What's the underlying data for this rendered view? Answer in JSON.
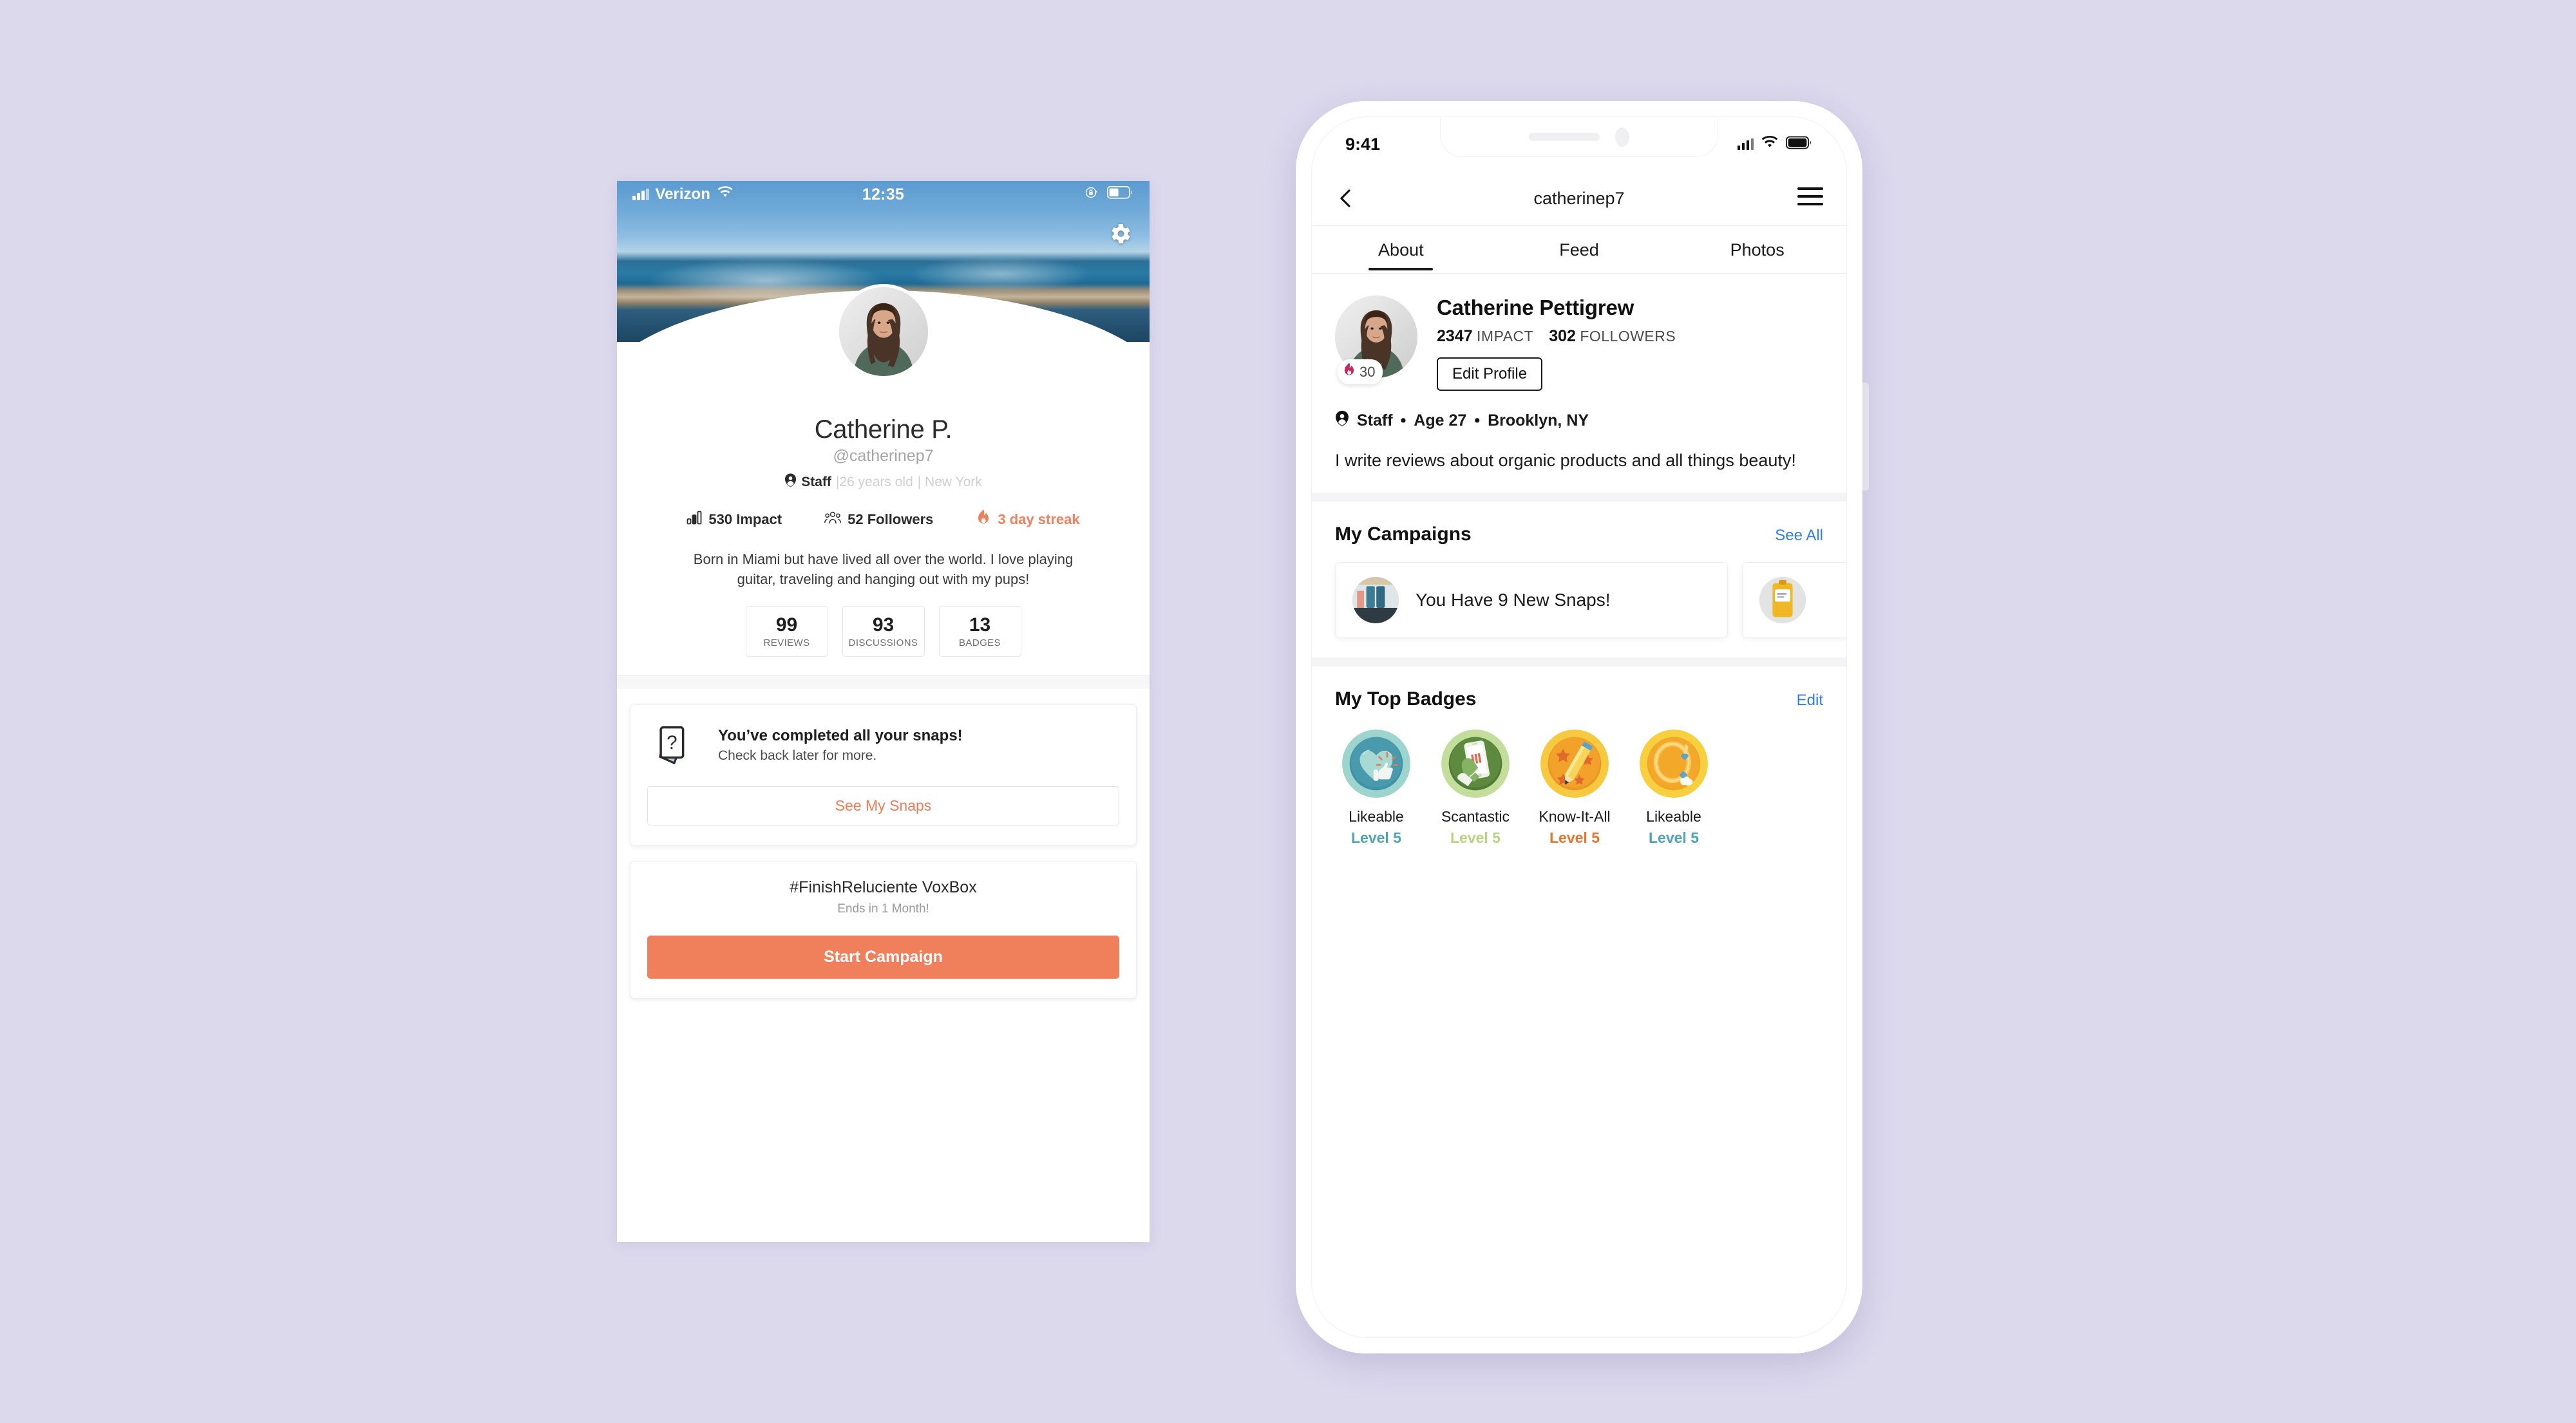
{
  "page": {
    "background_color": "#dcd9ed"
  },
  "left_phone": {
    "status_bar": {
      "carrier": "Verizon",
      "time": "12:35",
      "wifi_icon": "wifi-icon",
      "signal_icon": "signal-bars-icon",
      "orientation_lock_icon": "rotation-lock-icon",
      "battery_icon": "battery-icon"
    },
    "settings_icon": "gear-icon",
    "profile": {
      "avatar": "user-avatar",
      "name": "Catherine P.",
      "handle": "@catherinep7",
      "role_icon": "staff-badge-icon",
      "role": "Staff",
      "age": "|26 years old",
      "location": "| New York"
    },
    "stats": [
      {
        "icon": "impact-bars-icon",
        "label": "530 Impact"
      },
      {
        "icon": "followers-icon",
        "label": "52 Followers"
      },
      {
        "icon": "flame-icon",
        "label": "3 day streak",
        "color": "#f08060"
      }
    ],
    "bio": "Born in Miami but have lived all over the world. I love playing guitar, traveling and hanging out with my pups!",
    "counters": [
      {
        "value": "99",
        "label": "REVIEWS"
      },
      {
        "value": "93",
        "label": "DISCUSSIONS"
      },
      {
        "value": "13",
        "label": "BADGES"
      }
    ],
    "snaps_card": {
      "icon": "question-cards-icon",
      "heading": "You’ve completed all your snaps!",
      "subheading": "Check back later for more.",
      "button": "See My Snaps",
      "button_color": "#ef7b55"
    },
    "campaign_card": {
      "title": "#FinishReluciente VoxBox",
      "subtitle": "Ends in 1 Month!",
      "button": "Start Campaign",
      "button_color": "#f0805c"
    }
  },
  "right_phone": {
    "status_bar": {
      "time": "9:41",
      "signal_icon": "signal-bars-icon",
      "wifi_icon": "wifi-icon",
      "battery_icon": "battery-icon"
    },
    "nav": {
      "back_icon": "chevron-left-icon",
      "title": "catherinep7",
      "menu_icon": "hamburger-menu-icon"
    },
    "tabs": [
      {
        "label": "About",
        "active": true
      },
      {
        "label": "Feed",
        "active": false
      },
      {
        "label": "Photos",
        "active": false
      }
    ],
    "profile": {
      "avatar": "user-avatar",
      "streak_icon": "flame-icon",
      "streak_value": "30",
      "full_name": "Catherine Pettigrew",
      "impact_value": "2347",
      "impact_label": "IMPACT",
      "followers_value": "302",
      "followers_label": "FOLLOWERS",
      "edit_button": "Edit Profile",
      "role_icon": "staff-badge-icon",
      "role": "Staff",
      "age": "Age 27",
      "location": "Brooklyn, NY",
      "bio": "I write reviews about organic products and all things beauty!"
    },
    "campaigns_section": {
      "title": "My Campaigns",
      "see_all": "See All",
      "link_color": "#2f7fe8",
      "cards": [
        {
          "thumb": "campaign-thumbnail",
          "label": "You Have 9 New Snaps!"
        },
        {
          "thumb": "campaign-thumbnail",
          "label": ""
        }
      ]
    },
    "badges_section": {
      "title": "My Top Badges",
      "edit": "Edit",
      "link_color": "#2f7fe8",
      "badges": [
        {
          "icon": "heart-thumbsup-badge-icon",
          "name": "Likeable",
          "level": "Level 5",
          "ring": "#9ed4ce",
          "face": "#4a9aad",
          "level_color": "#4da4b4"
        },
        {
          "icon": "phone-scan-badge-icon",
          "name": "Scantastic",
          "level": "Level 5",
          "ring": "#c3dd9c",
          "face": "#5d8a3f",
          "level_color": "#b7d47f"
        },
        {
          "icon": "pencil-stars-badge-icon",
          "name": "Know-It-All",
          "level": "Level 5",
          "ring": "#f7c93f",
          "face": "#f2a22b",
          "level_color": "#e8762c"
        },
        {
          "icon": "bracelet-badge-icon",
          "name": "Likeable",
          "level": "Level 5",
          "ring": "#f8cf3e",
          "face": "#f4a82a",
          "level_color": "#4da4b4"
        }
      ]
    }
  }
}
